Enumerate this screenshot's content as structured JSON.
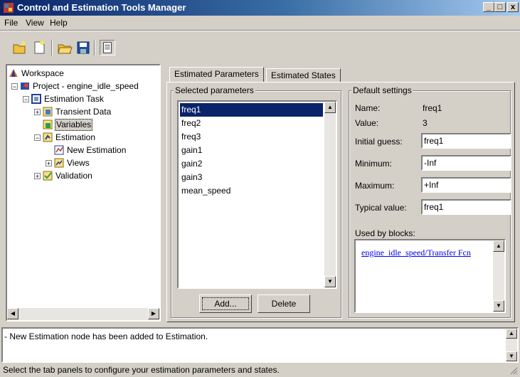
{
  "window": {
    "title": "Control and Estimation Tools Manager",
    "minimize": "_",
    "maximize": "□",
    "close": "x"
  },
  "menu": [
    "File",
    "View",
    "Help"
  ],
  "tree": {
    "workspace": "Workspace",
    "project": "Project - engine_idle_speed",
    "estimation_task": "Estimation Task",
    "transient_data": "Transient Data",
    "variables": "Variables",
    "estimation": "Estimation",
    "new_estimation": "New Estimation",
    "views": "Views",
    "validation": "Validation"
  },
  "tabs": [
    "Estimated Parameters",
    "Estimated States"
  ],
  "selected_parameters": {
    "legend": "Selected parameters",
    "items": [
      "freq1",
      "freq2",
      "freq3",
      "gain1",
      "gain2",
      "gain3",
      "mean_speed"
    ],
    "selected": "freq1",
    "add_label": "Add...",
    "delete_label": "Delete"
  },
  "default_settings": {
    "legend": "Default settings",
    "name_label": "Name:",
    "name_value": "freq1",
    "value_label": "Value:",
    "value_value": "3",
    "initial_guess_label": "Initial guess:",
    "initial_guess": "freq1",
    "minimum_label": "Minimum:",
    "minimum": "-Inf",
    "maximum_label": "Maximum:",
    "maximum": "+Inf",
    "typical_label": "Typical value:",
    "typical": "freq1",
    "used_by_label": "Used by blocks:",
    "used_by_link": "engine_idle_speed/Transfer Fcn"
  },
  "log": {
    "message": "- New Estimation node has been added to Estimation."
  },
  "status": {
    "text": "Select the tab panels to configure your estimation parameters and states."
  },
  "colors": {
    "title_bar": "#0a246a",
    "selection": "#0a246a",
    "face": "#d4d0c8"
  }
}
